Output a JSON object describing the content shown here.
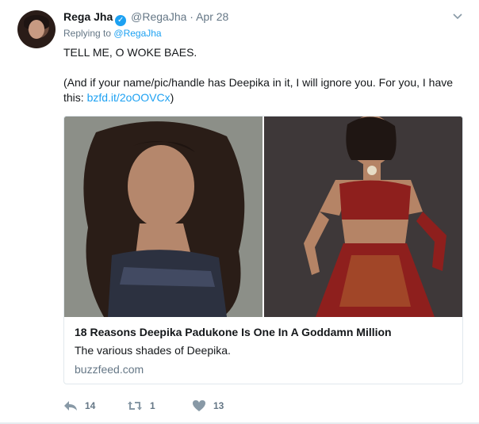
{
  "tweet": {
    "author_name": "Rega Jha",
    "handle": "@RegaJha",
    "separator": "·",
    "timestamp": "Apr 28",
    "replying_prefix": "Replying to",
    "replying_to": "@RegaJha",
    "line1": "TELL ME, O WOKE BAES.",
    "line2_text": "(And if your name/pic/handle has Deepika in it, I will ignore you. For you, I have this: ",
    "line2_link": "bzfd.it/2oOOVCx",
    "line2_end": ")"
  },
  "card": {
    "title": "18 Reasons Deepika Padukone Is One In A Goddamn Million",
    "description": "The various shades of Deepika.",
    "domain": "buzzfeed.com"
  },
  "actions": {
    "reply_count": "14",
    "retweet_count": "1",
    "like_count": "13"
  },
  "colors": {
    "link": "#1da1f2",
    "secondary_text": "#657786",
    "border": "#e1e8ed"
  },
  "icons": [
    "verified-badge-icon",
    "chevron-down-icon",
    "reply-icon",
    "retweet-icon",
    "heart-icon"
  ]
}
